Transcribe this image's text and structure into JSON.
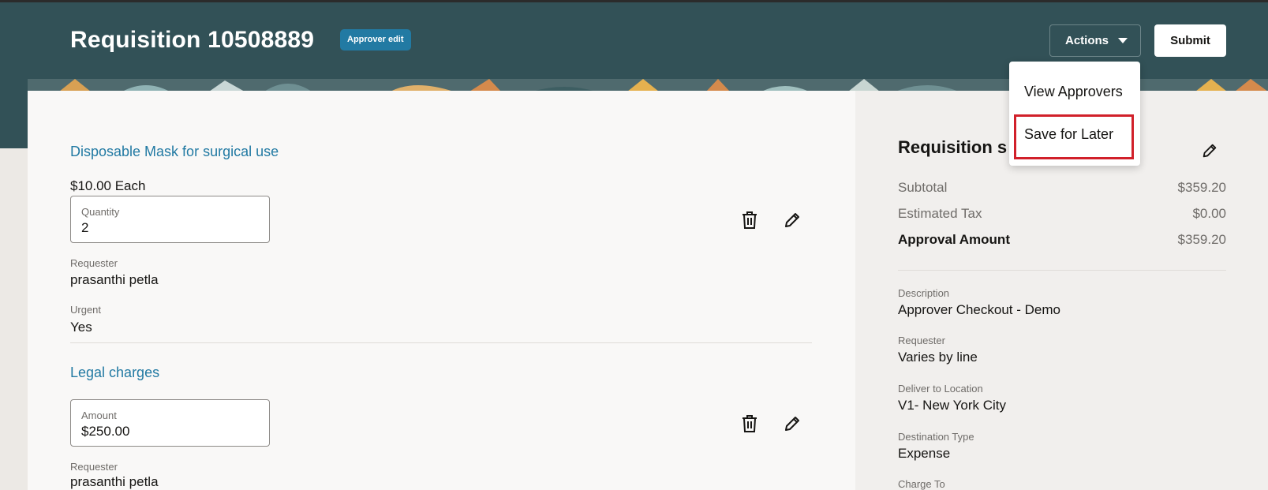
{
  "header": {
    "title": "Requisition 10508889",
    "badge": "Approver edit",
    "actions_label": "Actions",
    "submit_label": "Submit"
  },
  "actions_menu": {
    "items": [
      "View Approvers",
      "Save for Later"
    ],
    "highlighted": "Save for Later"
  },
  "lines": [
    {
      "name": "Disposable Mask for surgical use",
      "price": "$10.00 Each",
      "field_label": "Quantity",
      "field_value": "2",
      "requester_label": "Requester",
      "requester": "prasanthi petla",
      "urgent_label": "Urgent",
      "urgent": "Yes"
    },
    {
      "name": "Legal charges",
      "field_label": "Amount",
      "field_value": "$250.00",
      "requester_label": "Requester",
      "requester": "prasanthi petla"
    }
  ],
  "summary": {
    "title_partial": "Requisition s",
    "subtotal_label": "Subtotal",
    "subtotal": "$359.20",
    "tax_label": "Estimated Tax",
    "tax": "$0.00",
    "approval_label": "Approval Amount",
    "approval": "$359.20",
    "description_label": "Description",
    "description": "Approver Checkout - Demo",
    "requester_label": "Requester",
    "requester": "Varies by line",
    "deliver_label": "Deliver to Location",
    "deliver": "V1- New York City",
    "destination_label": "Destination Type",
    "destination": "Expense",
    "charge_label": "Charge To"
  },
  "icons": {
    "delete": "trash-icon",
    "edit": "pencil-icon",
    "dropdown": "caret-down-icon"
  },
  "colors": {
    "header_bg": "#325157",
    "link": "#227aa3",
    "badge": "#227aa3",
    "highlight": "#d1202a"
  }
}
